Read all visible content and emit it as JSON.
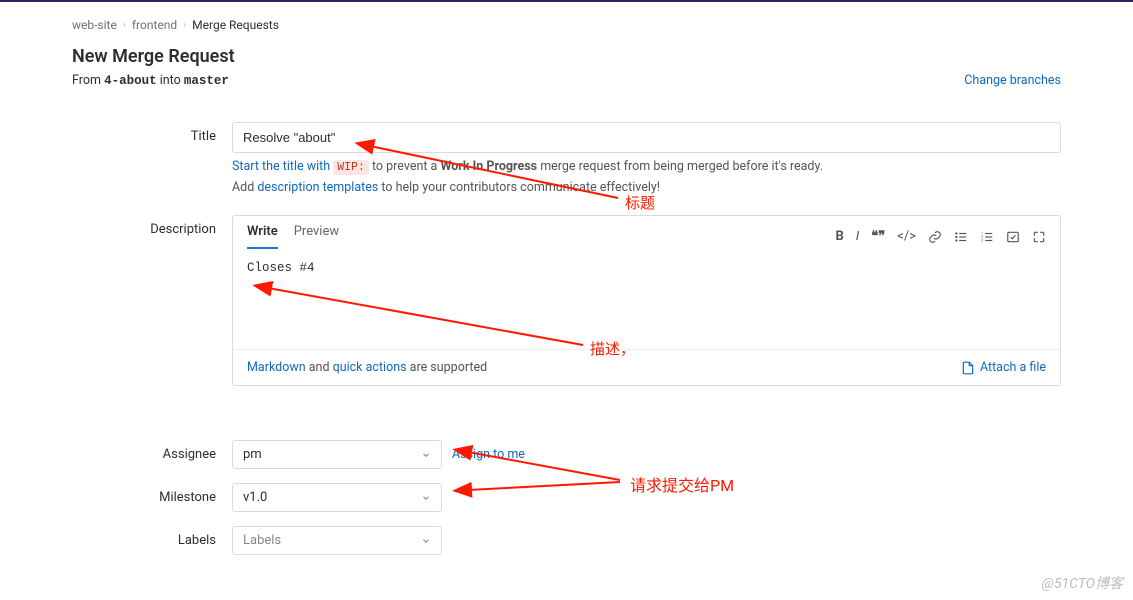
{
  "breadcrumb": {
    "project": "web-site",
    "subgroup": "frontend",
    "current": "Merge Requests"
  },
  "header": {
    "title": "New Merge Request",
    "from_prefix": "From",
    "from_branch": "4-about",
    "into_word": "into",
    "target_branch": "master",
    "change_branches": "Change branches"
  },
  "title_field": {
    "label": "Title",
    "value": "Resolve \"about\"",
    "hint_prefix": "Start the title with",
    "hint_code": "WIP:",
    "hint_mid": " to prevent a ",
    "hint_bold": "Work In Progress",
    "hint_suffix": " merge request from being merged before it's ready.",
    "tmpl_prefix": "Add ",
    "tmpl_link": "description templates",
    "tmpl_suffix": " to help your contributors communicate effectively!"
  },
  "description": {
    "label": "Description",
    "tab_write": "Write",
    "tab_preview": "Preview",
    "body": "Closes #4",
    "md_link": "Markdown",
    "and_word": " and ",
    "qa_link": "quick actions",
    "supported": " are supported",
    "attach": "Attach a file"
  },
  "assignee": {
    "label": "Assignee",
    "value": "pm",
    "assign_me": "Assign to me"
  },
  "milestone": {
    "label": "Milestone",
    "value": "v1.0"
  },
  "labels": {
    "label": "Labels",
    "placeholder": "Labels"
  },
  "annotations": {
    "title": "标题",
    "desc": "描述，",
    "pm": "请求提交给PM"
  },
  "watermark": "@51CTO博客"
}
